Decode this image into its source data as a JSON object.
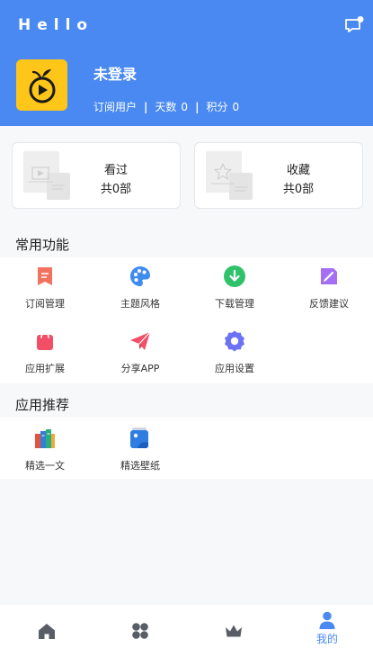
{
  "header": {
    "app_title": "Hello",
    "username": "未登录",
    "user_type": "订阅用户",
    "separator": "|",
    "days_label": "天数",
    "days_value": "0",
    "points_label": "积分",
    "points_value": "0"
  },
  "cards": [
    {
      "title": "看过",
      "count": "共0部"
    },
    {
      "title": "收藏",
      "count": "共0部"
    }
  ],
  "common_functions": {
    "title": "常用功能",
    "items": [
      {
        "label": "订阅管理",
        "icon": "subscribe-icon",
        "color": "#f1735f"
      },
      {
        "label": "主题风格",
        "icon": "palette-icon",
        "color": "#3f8cf0"
      },
      {
        "label": "下载管理",
        "icon": "download-icon",
        "color": "#2fc26b"
      },
      {
        "label": "反馈建议",
        "icon": "feedback-icon",
        "color": "#a46ff2"
      },
      {
        "label": "应用扩展",
        "icon": "bag-icon",
        "color": "#f24e65"
      },
      {
        "label": "分享APP",
        "icon": "paper-plane-icon",
        "color": "#f24e65"
      },
      {
        "label": "应用设置",
        "icon": "gear-icon",
        "color": "#6c72f4"
      }
    ]
  },
  "recommend": {
    "title": "应用推荐",
    "items": [
      {
        "label": "精选一文",
        "icon": "books-icon"
      },
      {
        "label": "精选壁纸",
        "icon": "wallpaper-icon"
      }
    ]
  },
  "tabbar": {
    "active_label": "我的",
    "accent": "#4a89f1",
    "inactive_color": "#595d66"
  }
}
